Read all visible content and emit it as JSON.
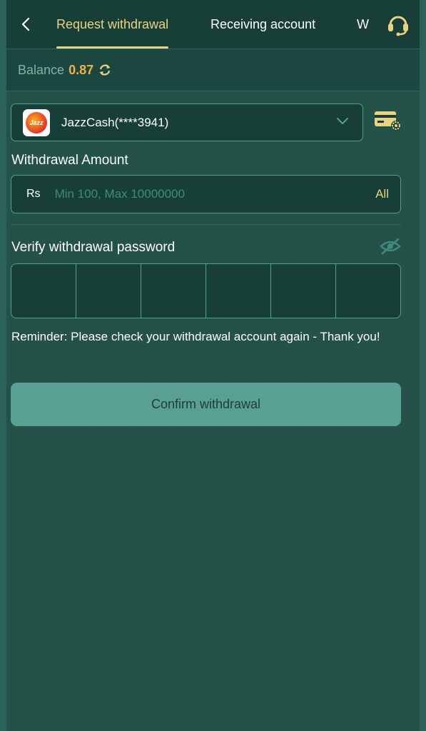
{
  "header": {
    "tabs": [
      {
        "label": "Request withdrawal"
      },
      {
        "label": "Receiving account"
      },
      {
        "label": "W"
      }
    ]
  },
  "balance": {
    "label": "Balance",
    "value": "0.87"
  },
  "account": {
    "logo_text": "Jazz",
    "name": "JazzCash(****3941)"
  },
  "amount": {
    "label": "Withdrawal Amount",
    "currency": "Rs",
    "placeholder": "Min 100, Max 10000000",
    "all_label": "All"
  },
  "password": {
    "label": "Verify withdrawal password"
  },
  "reminder": "Reminder: Please check your withdrawal account again - Thank you!",
  "confirm_label": "Confirm withdrawal",
  "colors": {
    "accent": "#e9d281",
    "balance": "#f0b04a",
    "background": "#245148",
    "button": "#5a9f94"
  },
  "icons": [
    "back-arrow-icon",
    "headset-icon",
    "refresh-icon",
    "chevron-down-icon",
    "card-settings-icon",
    "eye-hidden-icon"
  ]
}
